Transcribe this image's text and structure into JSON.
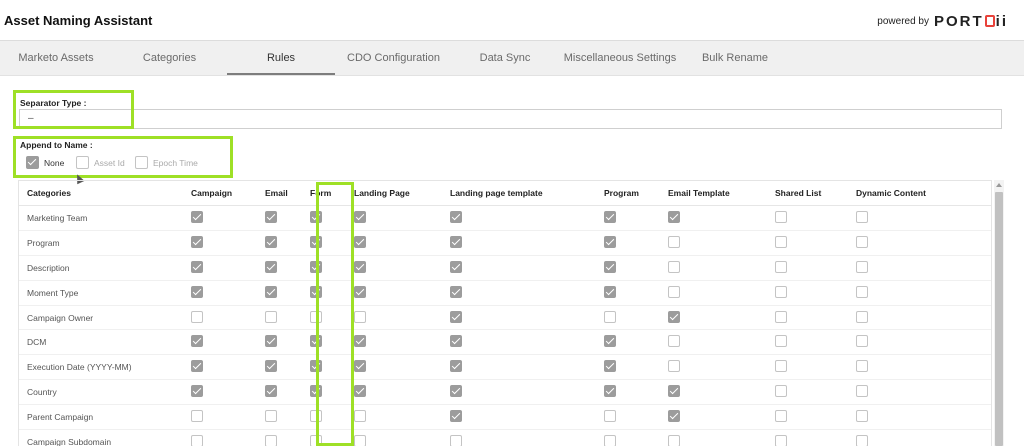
{
  "header": {
    "title": "Asset Naming Assistant",
    "powered_by": "powered by",
    "logo_text": "PORT",
    "logo_suffix": "ii"
  },
  "tabs": [
    {
      "label": "Marketo Assets"
    },
    {
      "label": "Categories"
    },
    {
      "label": "Rules",
      "active": true
    },
    {
      "label": "CDO Configuration"
    },
    {
      "label": "Data Sync"
    },
    {
      "label": "Miscellaneous Settings"
    },
    {
      "label": "Bulk Rename"
    }
  ],
  "separator": {
    "label": "Separator Type :",
    "value": "–"
  },
  "append": {
    "label": "Append to Name :",
    "options": [
      {
        "label": "None",
        "checked": true
      },
      {
        "label": "Asset Id",
        "checked": false
      },
      {
        "label": "Epoch Time",
        "checked": false
      }
    ]
  },
  "table": {
    "columns": [
      "Categories",
      "Campaign",
      "Email",
      "Form",
      "Landing Page",
      "Landing page template",
      "Program",
      "Email Template",
      "Shared List",
      "Dynamic Content"
    ],
    "rows": [
      {
        "name": "Marketing Team",
        "checks": [
          1,
          1,
          1,
          1,
          1,
          1,
          1,
          0,
          0
        ]
      },
      {
        "name": "Program",
        "checks": [
          1,
          1,
          1,
          1,
          1,
          1,
          0,
          0,
          0
        ]
      },
      {
        "name": "Description",
        "checks": [
          1,
          1,
          1,
          1,
          1,
          1,
          0,
          0,
          0
        ]
      },
      {
        "name": "Moment Type",
        "checks": [
          1,
          1,
          1,
          1,
          1,
          1,
          0,
          0,
          0
        ]
      },
      {
        "name": "Campaign Owner",
        "checks": [
          0,
          0,
          0,
          0,
          1,
          0,
          1,
          0,
          0
        ]
      },
      {
        "name": "DCM",
        "checks": [
          1,
          1,
          1,
          1,
          1,
          1,
          0,
          0,
          0
        ]
      },
      {
        "name": "Execution Date (YYYY-MM)",
        "checks": [
          1,
          1,
          1,
          1,
          1,
          1,
          0,
          0,
          0
        ]
      },
      {
        "name": "Country",
        "checks": [
          1,
          1,
          1,
          1,
          1,
          1,
          1,
          0,
          0
        ]
      },
      {
        "name": "Parent Campaign",
        "checks": [
          0,
          0,
          0,
          0,
          1,
          0,
          1,
          0,
          0
        ]
      },
      {
        "name": "Campaign Subdomain",
        "checks": [
          0,
          0,
          0,
          0,
          0,
          0,
          0,
          0,
          0
        ]
      }
    ]
  },
  "colors": {
    "highlight": "#9ee026",
    "checked": "#9c9c9c",
    "logo_accent": "#e8423a"
  }
}
